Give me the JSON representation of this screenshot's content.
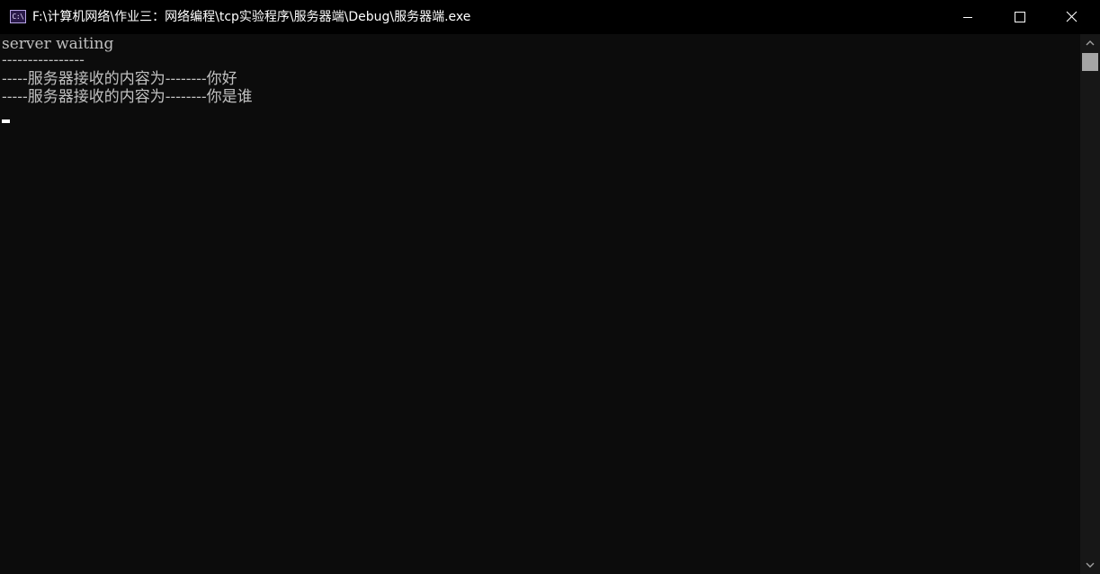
{
  "window": {
    "title": "F:\\计算机网络\\作业三：网络编程\\tcp实验程序\\服务器端\\Debug\\服务器端.exe",
    "icon_text": "C:\\",
    "icon": "console-icon"
  },
  "caption_buttons": {
    "minimize": "minimize-icon",
    "maximize": "maximize-icon",
    "close": "close-icon"
  },
  "console": {
    "lines": [
      "server waiting",
      "----------------",
      "-----服务器接收的内容为--------你好",
      "-----服务器接收的内容为--------你是谁"
    ]
  },
  "colors": {
    "console_background": "#0c0c0c",
    "console_text": "#c0c0c0",
    "titlebar": "#000000",
    "title_text": "#ffffff"
  }
}
